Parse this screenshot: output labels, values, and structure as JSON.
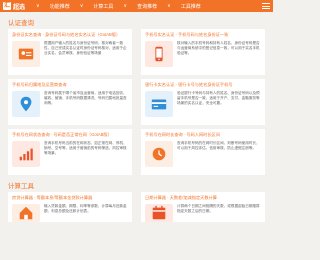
{
  "header": {
    "logo_char": "汇",
    "logo_text": "超选",
    "nav": [
      "∨",
      "功能推荐",
      "∨",
      "计算工具",
      "∨",
      "查询推荐",
      "∨",
      "工具推荐"
    ],
    "accent": "#f27227"
  },
  "section1": {
    "title": "认证查询"
  },
  "cards": [
    {
      "title": "身份证实名查询 · 身份证号码与姓名实名认证（GotAB版）",
      "desc": "根据用户输入的姓名与身份证号码，核对两者一致性，自己完成实名认证时身份证号码核对，适用于企业实名、会员审核、身份验证等场景",
      "icon": "id-card-icon",
      "color": "#f27227"
    },
    {
      "title": "手机号实名认证 · 手机号码与姓名身份证一致",
      "desc": "核对输入的手机号码和持有人姓名、身份证号码是否与运营商系统中的登记信息一致，可以用于实名手机验证等。",
      "icon": "phone-icon",
      "color": "#e8542a"
    },
    {
      "title": "手机号码归属地及运营商查询",
      "desc": "查询号码属于哪个省市及运营商，适用于电话回访、催收、营销、手机号码数据清洗、号码归属地批量查询等。",
      "icon": "location-pin-icon",
      "color": "#2f8fd8"
    },
    {
      "title": "银行卡实名认证 · 银行卡号与姓名身份证手机号",
      "desc": "验证银行卡号码与持有人的姓名、身份证号码以及预留手机号是否一致，适用于开户、支付、金融服务等场景的实名认证，安全可靠。",
      "icon": "bank-card-icon",
      "color": "#2f8fd8"
    },
    {
      "title": "手机号在网状态查询 · 号码是否正常在网（GotAB版）",
      "desc": "查询手机号码当前的在网状态，如正常在网、停机、销号、空号等，适用于营销前的号码筛选、风控审核等场景。",
      "icon": "signal-icon",
      "color": "#e8542a"
    },
    {
      "title": "手机号在网时长查询 · 号码入网时长区间",
      "desc": "查询手机号码的在网时长区间，判断号码使用时长，可以用于风控评估、信用审核、防止虚假注册等。",
      "icon": "clock-icon",
      "color": "#f27227"
    }
  ],
  "section2": {
    "title": "计算工具"
  },
  "cards2": [
    {
      "title": "房贷计算器 · 等额本息/等额本金贷款计算器",
      "desc": "输入贷款金额、期限、利率等参数，计算每月还款金额、利息总额及还款计划表。",
      "icon": "house-icon",
      "color": "#f27227"
    },
    {
      "title": "日期计算器 · 天数差/加减指定天数计算",
      "desc": "计算两个日期之间相隔的天数，或根据起始日期推算指定天数之后的日期。",
      "icon": "calendar-icon",
      "color": "#e8542a"
    }
  ]
}
